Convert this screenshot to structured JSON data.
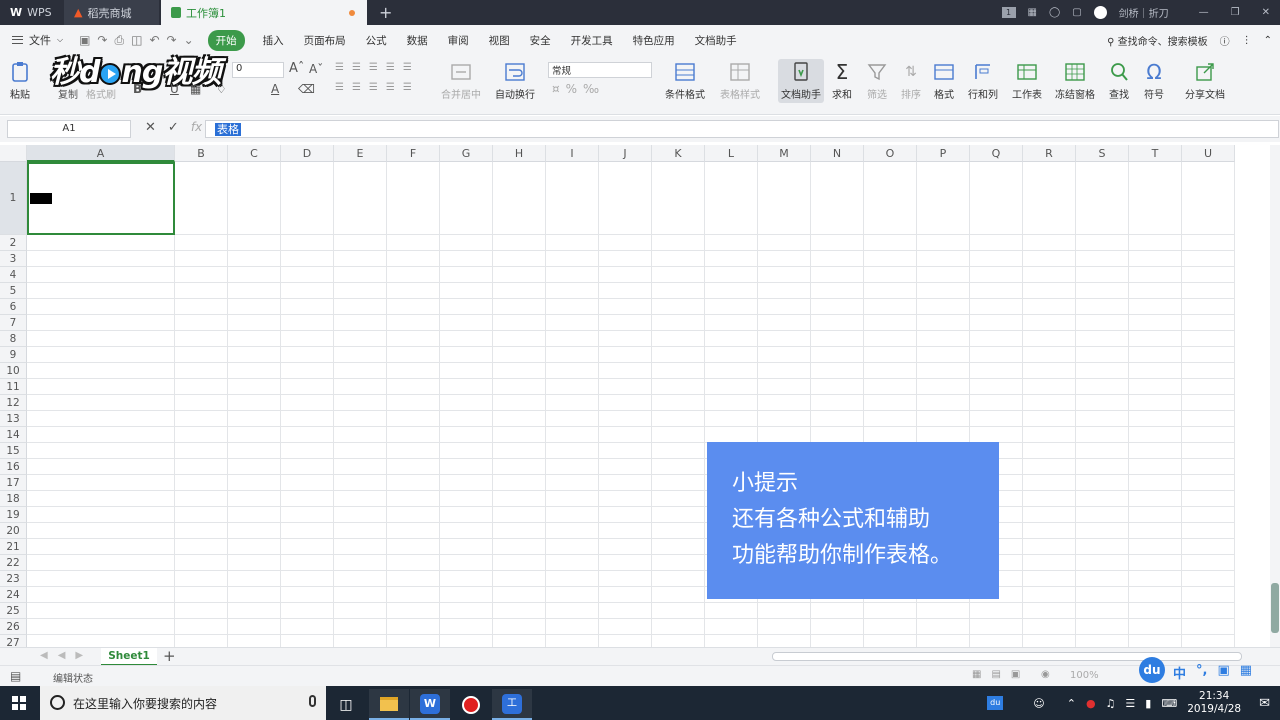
{
  "titlebar": {
    "tabs": [
      {
        "label": "WPS"
      },
      {
        "label": "稻壳商城"
      },
      {
        "label": "工作簿1"
      }
    ],
    "badge": "1",
    "user": "剑桥｜折刀"
  },
  "menubar": {
    "file": "文件",
    "items": [
      "开始",
      "插入",
      "页面布局",
      "公式",
      "数据",
      "审阅",
      "视图",
      "安全",
      "开发工具",
      "特色应用",
      "文档助手"
    ],
    "active": "开始",
    "search": "查找命令、搜索模板"
  },
  "ribbon": {
    "paste": "粘贴",
    "copy": "复制",
    "format_painter": "格式刷",
    "font_size": "0",
    "merge_center": "合并居中",
    "wrap_text": "自动换行",
    "number_format": "常规",
    "conditional_format": "条件格式",
    "table_style": "表格样式",
    "doc_assistant": "文档助手",
    "sum": "求和",
    "filter": "筛选",
    "sort": "排序",
    "format": "格式",
    "row_col": "行和列",
    "worksheet": "工作表",
    "freeze": "冻结窗格",
    "find": "查找",
    "symbol": "符号",
    "share": "分享文档",
    "watermark": "秒dong视频"
  },
  "formula_bar": {
    "name_box": "A1",
    "fx": "fx",
    "content": "表格"
  },
  "sheet": {
    "columns": [
      "A",
      "B",
      "C",
      "D",
      "E",
      "F",
      "G",
      "H",
      "I",
      "J",
      "K",
      "L",
      "M",
      "N",
      "O",
      "P",
      "Q",
      "R",
      "S",
      "T",
      "U"
    ],
    "rows": [
      "1",
      "2",
      "3",
      "4",
      "5",
      "6",
      "7",
      "8",
      "9",
      "10",
      "11",
      "12",
      "13",
      "14",
      "15",
      "16",
      "17",
      "18",
      "19",
      "20",
      "21",
      "22",
      "23",
      "24",
      "25",
      "26",
      "27"
    ],
    "tab": "Sheet1"
  },
  "tip": {
    "line1": "小提示",
    "line2": "还有各种公式和辅助",
    "line3": "功能帮助你制作表格。"
  },
  "status": {
    "mode": "编辑状态",
    "zoom": "100%"
  },
  "ime": {
    "du": "du",
    "lang": "中"
  },
  "taskbar": {
    "search_placeholder": "在这里输入你要搜索的内容",
    "time": "21:34",
    "date": "2019/4/28"
  }
}
